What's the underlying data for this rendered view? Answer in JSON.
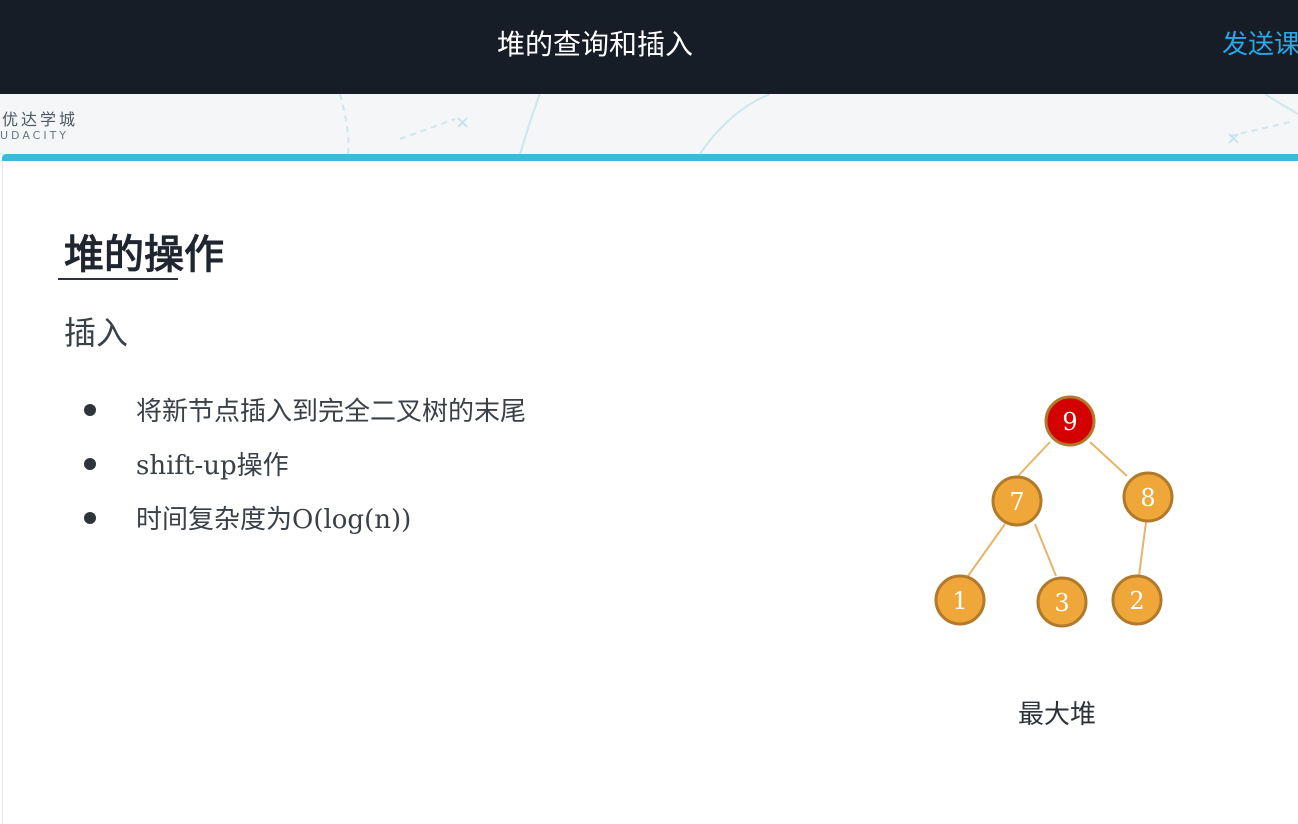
{
  "header": {
    "title": "堆的查询和插入",
    "action_label": "发送课"
  },
  "brand": {
    "name_cn": "优达学城",
    "name_en": "UDACITY"
  },
  "slide": {
    "title": "堆的操作",
    "subtitle": "插入",
    "bullets": [
      "将新节点插入到完全二叉树的末尾",
      "shift-up操作",
      "时间复杂度为O(log(n))"
    ]
  },
  "heap_diagram": {
    "caption": "最大堆",
    "nodes": [
      {
        "label": "9",
        "highlighted": true
      },
      {
        "label": "7",
        "highlighted": false
      },
      {
        "label": "8",
        "highlighted": false
      },
      {
        "label": "1",
        "highlighted": false
      },
      {
        "label": "3",
        "highlighted": false
      },
      {
        "label": "2",
        "highlighted": false
      }
    ],
    "edges": [
      [
        "9",
        "7"
      ],
      [
        "9",
        "8"
      ],
      [
        "7",
        "1"
      ],
      [
        "7",
        "3"
      ],
      [
        "8",
        "2"
      ]
    ],
    "colors": {
      "highlight_fill": "#d40000",
      "node_fill": "#f0a73a",
      "node_stroke": "#b07a2a",
      "edge": "#e6b46a"
    }
  },
  "colors": {
    "topbar_bg": "#161d27",
    "accent": "#3db9de",
    "link": "#2aa7e6"
  }
}
